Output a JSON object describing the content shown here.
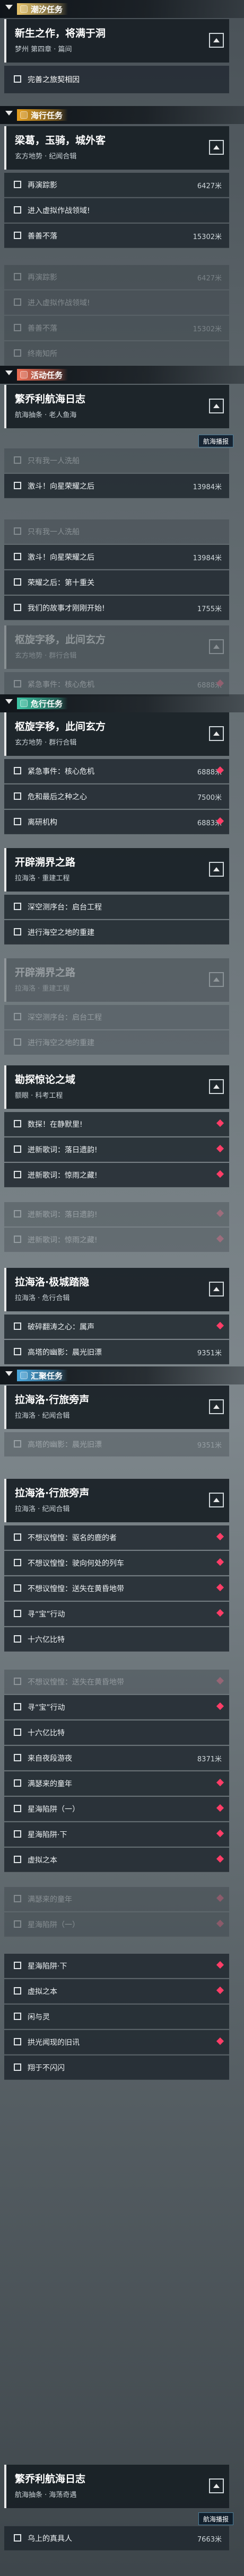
{
  "sections": {
    "tide": {
      "label": "潮汐任务",
      "color": "#e8c46a"
    },
    "sea": {
      "label": "海行任务",
      "color": "#e6a020"
    },
    "event": {
      "label": "活动任务",
      "color": "#ee6e54"
    },
    "danger": {
      "label": "危行任务",
      "color": "#3ec7a6"
    },
    "gather": {
      "label": "汇聚任务",
      "color": "#4aa8de"
    }
  },
  "hint": "航海播报",
  "cards": [
    {
      "title": "新生之作，将满于洞",
      "sub": "梦州 第四章 · 篇间"
    },
    {
      "title": "梁葛，玉骑，城外客",
      "sub": "玄方地势 · 纪闻合辑"
    },
    {
      "title": "繁乔利航海日志",
      "sub": "航海抽条 · 老人鱼海"
    },
    {
      "title": "枢旋字移，此间玄方",
      "sub": "玄方地势 · 群行合辑"
    },
    {
      "title": "枢旋字移，此间玄方",
      "sub": "玄方地势 · 群行合辑"
    },
    {
      "title": "开辟溯界之路",
      "sub": "拉海洛 · 重建工程"
    },
    {
      "title": "开辟溯界之路",
      "sub": "拉海洛 · 重建工程"
    },
    {
      "title": "勘探惊论之域",
      "sub": "额眼 · 科考工程"
    },
    {
      "title": "拉海洛·极城踏隐",
      "sub": "拉海洛 · 危行合辑"
    },
    {
      "title": "拉海洛·行旅旁声",
      "sub": "拉海洛 · 纪闻合辑"
    },
    {
      "title": "拉海洛·行旅旁声",
      "sub": "拉海洛 · 纪闻合辑"
    },
    {
      "title": "繁乔利航海日志",
      "sub": "航海抽条 · 海荡奇遇"
    }
  ],
  "unlock": "完善之旅契相因",
  "objectives": {
    "a1": "再演踪影",
    "a1d": "6427米",
    "a2": "进入虚拟作战领域!",
    "a3": "善善不落",
    "a3d": "15302米",
    "a4": "再演踪影",
    "a4d": "6427米",
    "a5": "进入虚拟作战领域!",
    "a6": "善善不落",
    "a6d": "15302米",
    "a7": "终南知所",
    "b1": "只有我一人洗船",
    "b2": "激斗！向星荣耀之后",
    "b2d": "13984米",
    "b3": "只有我一人洗船",
    "b4": "激斗！向星荣耀之后",
    "b4d": "13984米",
    "b5": "荣耀之后：第十重关",
    "b6": "我们的故事才刚刚开始!",
    "b6d": "1755米",
    "c1": "紧急事件：核心危机",
    "c1d": "6888米",
    "c2": "紧急事件：核心危机",
    "c2d": "6888米",
    "c3": "危和最后之种之心",
    "c3d": "7500米",
    "c4": "离研机构",
    "c4d": "6883米",
    "d1": "深空测序台：启台工程",
    "d2": "进行海空之地的重建",
    "d3": "深空测序台：启台工程",
    "d4": "进行海空之地的重建",
    "e1": "数探！在静默里!",
    "e2": "迸新歌词：落日遗韵!",
    "e3": "迸新歌词：惊雨之藏!",
    "e4": "迸新歌词：落日遗韵!",
    "e5": "迸新歌词：惊雨之藏!",
    "f1": "破碎翻涛之心：属声",
    "f2": "高塔的幽影：晨光旧漂",
    "f2d": "9351米",
    "f3": "高塔的幽影：晨光旧漂",
    "f3d": "9351米",
    "g1": "不想议惶惶：驱名的鹿的者",
    "g2": "不想议惶惶：驶向何处的列车",
    "g3": "不想议惶惶：送失在黄昏地带",
    "g4": "寻“宝”行动",
    "g5": "十六亿比特",
    "g6": "不想议惶惶：送失在黄昏地带",
    "g7": "寻“宝”行动",
    "g8": "十六亿比特",
    "g9": "来自夜段游夜",
    "g9d": "8371米",
    "g10": "满瑟来的童年",
    "g11": "星海陷阱（一）",
    "g12": "星海陷阱·下",
    "g13": "虚拟之本",
    "g14": "满瑟来的童年",
    "g15": "星海陷阱（一）",
    "g16": "星海陷阱·下",
    "g17": "虚拟之本",
    "g18": "闲与灵",
    "g19": "拱光闻现的旧讯",
    "g20": "翔于不闪闪",
    "h1": "乌上的真具人",
    "h1d": "7663米"
  }
}
